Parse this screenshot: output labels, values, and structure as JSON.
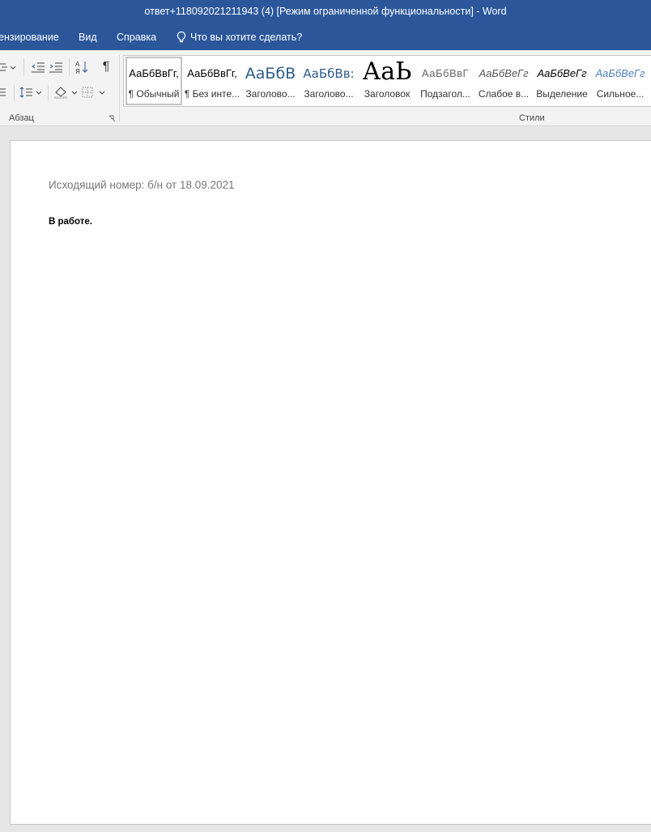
{
  "window": {
    "title": "ответ+118092021211943 (4) [Режим ограниченной функциональности]  -  Word"
  },
  "tabs": {
    "review": "ензирование",
    "view": "Вид",
    "help": "Справка",
    "tell_me": "Что вы хотите сделать?"
  },
  "ribbon": {
    "paragraph_group_label": "Абзац",
    "styles_group_label": "Стили",
    "styles": [
      {
        "preview": "АаБбВвГг,",
        "name": "¶ Обычный",
        "selected": true
      },
      {
        "preview": "АаБбВвГг,",
        "name": "¶ Без инте...",
        "selected": false
      },
      {
        "preview": "АаБбВ",
        "name": "Заголово...",
        "selected": false
      },
      {
        "preview": "АаБбВв:",
        "name": "Заголово...",
        "selected": false
      },
      {
        "preview": "АаЬ",
        "name": "Заголовок",
        "selected": false
      },
      {
        "preview": "АаБбВвГ",
        "name": "Подзагол...",
        "selected": false
      },
      {
        "preview": "АаБбВеГг",
        "name": "Слабое в...",
        "selected": false
      },
      {
        "preview": "АаБбВеГг",
        "name": "Выделение",
        "selected": false
      },
      {
        "preview": "АаБбВеГг",
        "name": "Сильное...",
        "selected": false
      }
    ]
  },
  "document": {
    "outgoing_number": "Исходящий номер: б/н от 18.09.2021",
    "status": "В работе."
  },
  "colors": {
    "title_bar": "#2b579a",
    "ribbon": "#f3f3f3",
    "page": "#ffffff",
    "workspace": "#e6e6e6"
  }
}
